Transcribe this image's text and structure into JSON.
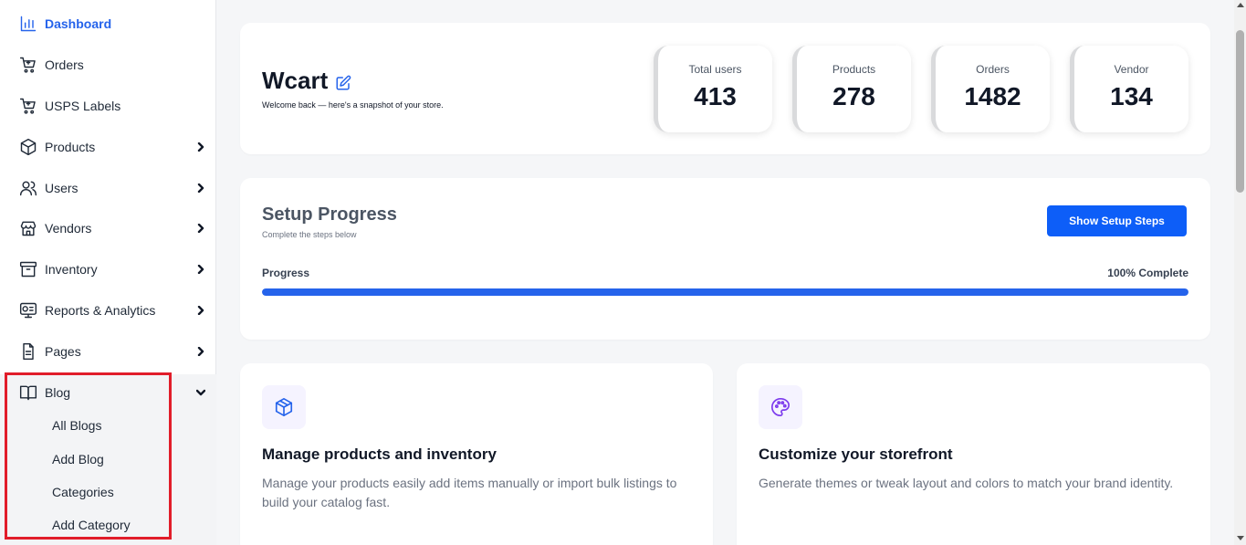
{
  "sidebar": {
    "items": [
      {
        "label": "Dashboard",
        "icon": "bar-chart-icon",
        "active": true
      },
      {
        "label": "Orders",
        "icon": "cart-icon"
      },
      {
        "label": "USPS Labels",
        "icon": "cart-icon"
      },
      {
        "label": "Products",
        "icon": "box-icon",
        "chevron": "right"
      },
      {
        "label": "Users",
        "icon": "users-icon",
        "chevron": "right"
      },
      {
        "label": "Vendors",
        "icon": "store-icon",
        "chevron": "right"
      },
      {
        "label": "Inventory",
        "icon": "archive-icon",
        "chevron": "right"
      },
      {
        "label": "Reports & Analytics",
        "icon": "monitor-chart-icon",
        "chevron": "right"
      },
      {
        "label": "Pages",
        "icon": "document-icon",
        "chevron": "right"
      },
      {
        "label": "Blog",
        "icon": "book-icon",
        "chevron": "down",
        "expanded": true
      }
    ],
    "blog_subitems": [
      "All Blogs",
      "Add Blog",
      "Categories",
      "Add Category"
    ]
  },
  "hero": {
    "title": "Wcart",
    "subtitle": "Welcome back — here's a snapshot of your store.",
    "stats": [
      {
        "label": "Total users",
        "value": "413"
      },
      {
        "label": "Products",
        "value": "278"
      },
      {
        "label": "Orders",
        "value": "1482"
      },
      {
        "label": "Vendor",
        "value": "134"
      }
    ]
  },
  "setup": {
    "title": "Setup Progress",
    "subtitle": "Complete the steps below",
    "button_label": "Show Setup Steps",
    "progress_label": "Progress",
    "progress_text": "100% Complete",
    "progress_percent": 100
  },
  "features": [
    {
      "title": "Manage products and inventory",
      "description": "Manage your products easily add items manually or import bulk listings to build your catalog fast.",
      "icon": "package-icon",
      "icon_color": "#2563eb",
      "icon_bg": "#f5f3ff"
    },
    {
      "title": "Customize your storefront",
      "description": "Generate themes or tweak layout and colors to match your brand identity.",
      "icon": "palette-icon",
      "icon_color": "#7c3aed",
      "icon_bg": "#f5f3ff"
    }
  ],
  "colors": {
    "accent": "#2563eb",
    "button": "#0d5ef8",
    "highlight": "#e11d2a"
  }
}
